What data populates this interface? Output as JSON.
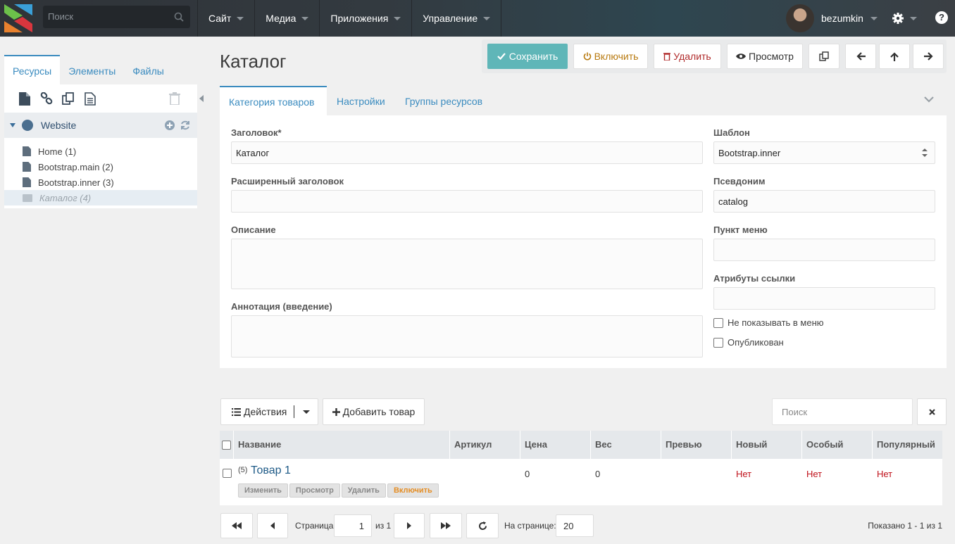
{
  "topbar": {
    "search_placeholder": "Поиск",
    "nav": [
      "Сайт",
      "Медиа",
      "Приложения",
      "Управление"
    ],
    "username": "bezumkin",
    "help": "?"
  },
  "left": {
    "tabs": [
      "Ресурсы",
      "Элементы",
      "Файлы"
    ],
    "root": "Website",
    "items": [
      "Home (1)",
      "Bootstrap.main (2)",
      "Bootstrap.inner (3)",
      "Каталог (4)"
    ]
  },
  "page": {
    "title": "Каталог",
    "actions": {
      "save": "Сохранить",
      "enable": "Включить",
      "delete": "Удалить",
      "preview": "Просмотр"
    },
    "tabs": [
      "Категория товаров",
      "Настройки",
      "Группы ресурсов"
    ]
  },
  "form": {
    "title_label": "Заголовок*",
    "title_value": "Каталог",
    "longtitle_label": "Расширенный заголовок",
    "longtitle_value": "",
    "description_label": "Описание",
    "description_value": "",
    "introtext_label": "Аннотация (введение)",
    "introtext_value": "",
    "template_label": "Шаблон",
    "template_value": "Bootstrap.inner",
    "alias_label": "Псевдоним",
    "alias_value": "catalog",
    "menutitle_label": "Пункт меню",
    "menutitle_value": "",
    "linkattr_label": "Атрибуты ссылки",
    "linkattr_value": "",
    "hidemenu_label": "Не показывать в меню",
    "published_label": "Опубликован"
  },
  "grid": {
    "actions_label": "Действия",
    "add_label": "Добавить товар",
    "search_placeholder": "Поиск",
    "columns": [
      "Название",
      "Артикул",
      "Цена",
      "Вес",
      "Превью",
      "Новый",
      "Особый",
      "Популярный"
    ],
    "rows": [
      {
        "id": "(5)",
        "name": "Товар 1",
        "article": "",
        "price": "0",
        "weight": "0",
        "new": "Нет",
        "special": "Нет",
        "popular": "Нет"
      }
    ],
    "row_buttons": [
      "Изменить",
      "Просмотр",
      "Удалить",
      "Включить"
    ]
  },
  "pager": {
    "page_label": "Страница",
    "page_value": "1",
    "of_label": "из 1",
    "per_page_label": "На странице:",
    "per_page_value": "20",
    "shown": "Показано 1 - 1 из 1"
  }
}
